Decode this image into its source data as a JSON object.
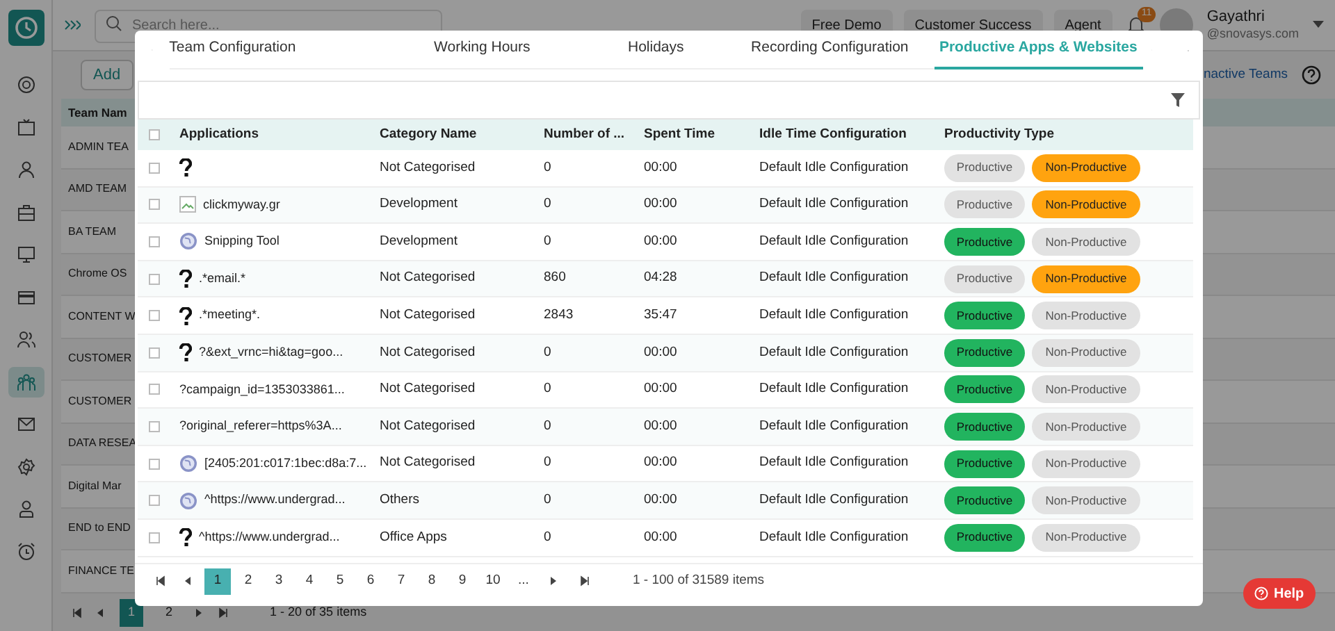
{
  "app": {
    "search_placeholder": "Search here...",
    "top_buttons": [
      "Free Demo",
      "Customer Success",
      "Agent"
    ],
    "notification_count": "11",
    "user_name": "Gayathri",
    "user_email": "@snovasys.com",
    "sidebar": [
      {
        "selected": false
      },
      {
        "selected": false
      },
      {
        "selected": false
      },
      {
        "selected": false
      },
      {
        "selected": false
      },
      {
        "selected": false
      },
      {
        "selected": false
      },
      {
        "selected": true
      },
      {
        "selected": false
      },
      {
        "selected": false
      },
      {
        "selected": false
      },
      {
        "selected": false
      }
    ],
    "add_button": "Add",
    "inactive_link": "nactive Teams",
    "teams_column": "Team Nam",
    "teams": [
      "ADMIN TEA",
      "AMD TEAM",
      "BA TEAM",
      "Chrome OS",
      "CONTENT W",
      "CUSTOMER",
      "CUSTOMER",
      "DATA RESEA",
      "Digital Mar",
      "END to END",
      "FINANCE TE"
    ],
    "pages": [
      {
        "label": "1",
        "selected": true
      },
      {
        "label": "2",
        "selected": false
      }
    ],
    "page_summary": "1 - 20 of 35 items",
    "help": "Help"
  },
  "modal": {
    "tabs": [
      {
        "label": "Team Configuration",
        "selected": false
      },
      {
        "label": "Working Hours",
        "selected": false
      },
      {
        "label": "Holidays",
        "selected": false
      },
      {
        "label": "Recording Configuration",
        "selected": false
      },
      {
        "label": "Productive Apps & Websites",
        "selected": true
      }
    ],
    "all_checked": false,
    "columns": [
      "Applications",
      "Category Name",
      "Number of ...",
      "Spent Time",
      "Idle Time Configuration",
      "Productivity Type"
    ],
    "rows": [
      {
        "checked": false,
        "kind": "question",
        "category": "Not Categorised",
        "number": "0",
        "spent": "00:00",
        "idle": "Default Idle Configuration",
        "productive_label": "Productive",
        "non_productive_label": "Non-Productive",
        "productive": false
      },
      {
        "checked": false,
        "kind": "broken-image",
        "application": "clickmyway.gr",
        "category": "Development",
        "number": "0",
        "spent": "00:00",
        "idle": "Default Idle Configuration",
        "productive_label": "Productive",
        "non_productive_label": "Non-Productive",
        "productive": false
      },
      {
        "checked": false,
        "kind": "globe",
        "application": "Snipping Tool",
        "category": "Development",
        "number": "0",
        "spent": "00:00",
        "idle": "Default Idle Configuration",
        "productive_label": "Productive",
        "non_productive_label": "Non-Productive",
        "productive": true
      },
      {
        "checked": false,
        "kind": "question",
        "application": ".*email.*",
        "category": "Not Categorised",
        "number": "860",
        "spent": "04:28",
        "idle": "Default Idle Configuration",
        "productive_label": "Productive",
        "non_productive_label": "Non-Productive",
        "productive": false
      },
      {
        "checked": false,
        "kind": "question",
        "application": ".*meeting*.",
        "category": "Not Categorised",
        "number": "2843",
        "spent": "35:47",
        "idle": "Default Idle Configuration",
        "productive_label": "Productive",
        "non_productive_label": "Non-Productive",
        "productive": true
      },
      {
        "checked": false,
        "kind": "question",
        "application": "?&ext_vrnc=hi&tag=goo...",
        "category": "Not Categorised",
        "number": "0",
        "spent": "00:00",
        "idle": "Default Idle Configuration",
        "productive_label": "Productive",
        "non_productive_label": "Non-Productive",
        "productive": true
      },
      {
        "checked": false,
        "kind": "text",
        "application": "?campaign_id=1353033861...",
        "category": "Not Categorised",
        "number": "0",
        "spent": "00:00",
        "idle": "Default Idle Configuration",
        "productive_label": "Productive",
        "non_productive_label": "Non-Productive",
        "productive": true
      },
      {
        "checked": false,
        "kind": "text",
        "application": "?original_referer=https%3A...",
        "category": "Not Categorised",
        "number": "0",
        "spent": "00:00",
        "idle": "Default Idle Configuration",
        "productive_label": "Productive",
        "non_productive_label": "Non-Productive",
        "productive": true
      },
      {
        "checked": false,
        "kind": "globe",
        "application": "[2405:201:c017:1bec:d8a:7...",
        "category": "Not Categorised",
        "number": "0",
        "spent": "00:00",
        "idle": "Default Idle Configuration",
        "productive_label": "Productive",
        "non_productive_label": "Non-Productive",
        "productive": true
      },
      {
        "checked": false,
        "kind": "globe",
        "application": "^https://www.undergrad...",
        "category": "Others",
        "number": "0",
        "spent": "00:00",
        "idle": "Default Idle Configuration",
        "productive_label": "Productive",
        "non_productive_label": "Non-Productive",
        "productive": true
      },
      {
        "checked": false,
        "kind": "question",
        "application": "^https://www.undergrad...",
        "category": "Office Apps",
        "number": "0",
        "spent": "00:00",
        "idle": "Default Idle Configuration",
        "productive_label": "Productive",
        "non_productive_label": "Non-Productive",
        "productive": true
      }
    ],
    "pages": [
      {
        "label": "1",
        "selected": true
      },
      {
        "label": "2",
        "selected": false
      },
      {
        "label": "3",
        "selected": false
      },
      {
        "label": "4",
        "selected": false
      },
      {
        "label": "5",
        "selected": false
      },
      {
        "label": "6",
        "selected": false
      },
      {
        "label": "7",
        "selected": false
      },
      {
        "label": "8",
        "selected": false
      },
      {
        "label": "9",
        "selected": false
      },
      {
        "label": "10",
        "selected": false
      },
      {
        "label": "...",
        "selected": false
      }
    ],
    "page_summary": "1 - 100 of 31589 items"
  }
}
